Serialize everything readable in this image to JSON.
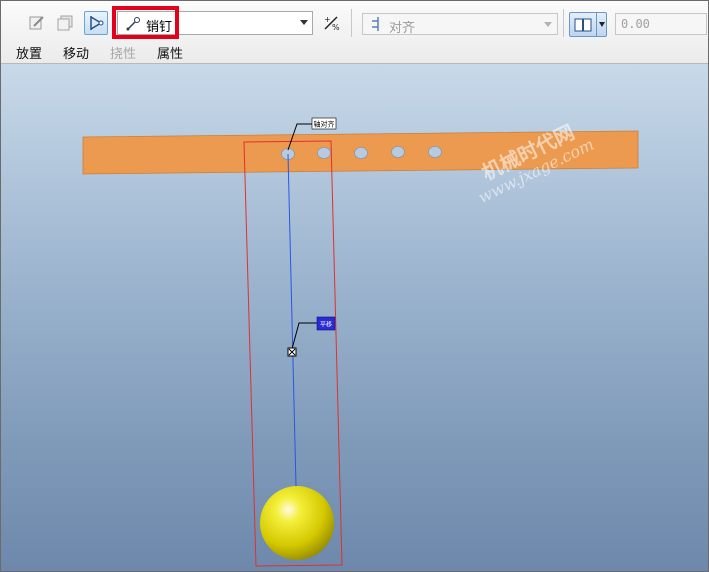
{
  "toolbar": {
    "component_type": "销钉",
    "constraint_type": "对齐",
    "offset_value": "0.00"
  },
  "tabs": [
    {
      "label": "放置",
      "enabled": true
    },
    {
      "label": "移动",
      "enabled": true
    },
    {
      "label": "挠性",
      "enabled": false
    },
    {
      "label": "属性",
      "enabled": true
    }
  ],
  "viewport": {
    "callout_top": "轴对齐",
    "callout_mid": "平移"
  },
  "watermark": {
    "line1": "机械时代网",
    "line2": "www.jxage.com"
  },
  "colors": {
    "highlight": "#e3001b",
    "part_bar": "#ec9a4f",
    "sphere": "#e8e000",
    "bbox": "#e03030",
    "axis_line": "#2a55e8"
  }
}
